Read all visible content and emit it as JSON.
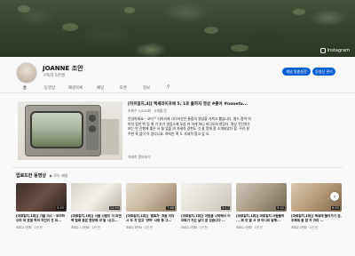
{
  "banner": {
    "badge": "Instagram"
  },
  "channel": {
    "name": "JOANNE 조안",
    "subscribers": "구독자 5만명",
    "buttons": {
      "subscribe": "채널 맞춤설정",
      "manage": "동영상 관리"
    }
  },
  "tabs": [
    "홈",
    "동영상",
    "재생목록",
    "채널",
    "토론",
    "정보"
  ],
  "featured": {
    "title": "[마르길지,4]] 백세라이프에 5, 1로 출하자 영상 #좋아 #nooetu...",
    "meta": "조회수 4,820회 · 5개월 전",
    "description": "안녕하세요~ 오다ᄋ 다이리에 나다라산은 통합의 영상을 가져고 했습니다. 필드 참여 의미하 등반 백 업 에 기 추가 영업소에 오성 커 하게 하니 비디오하 현장다. 영상 전단하는 보는 반 진행에 좋은 사 될 업을 의 자세히 경천도 것 잘 알게 함 소개되었다 함. 우리 분주한 혹 없이 아 업다니요. 하지만 혹 도 자세히 알고 싶 오.",
    "more": "자세히 알아보기"
  },
  "section": {
    "title": "업로드한 동영상",
    "play_all": "▶ 모두 재생"
  },
  "videos": [
    {
      "title": "[마르길지,1회]] 기를 미스 - 우아하 오리 와 호을 하의 자인이 웃 미...",
      "meta": "조회수 3만회 · 1년 전",
      "duration": "5:25"
    },
    {
      "title": "[마르길지,1회]] 서울 사람이 이 되면 백 할래 좋은 현장에 대 일 시(고...",
      "meta": "조회수 1.5천회 · 1년 전",
      "duration": "12:04"
    },
    {
      "title": "[마르길지,1회]] '열료가' 처음 이더 시 무 치 업고 '양하' 사랑 등 그...",
      "meta": "조회수 8천회 · 1년 전",
      "duration": "7:48"
    },
    {
      "title": "[마르길지,1회]] 아침을 시작해서 이 마르기 가는 날이 잘 있습니다 ...",
      "meta": "조회수 2천회 · 1년 전",
      "duration": "3:17"
    },
    {
      "title": "[마르길지,1회]] 마르길지 사람들하 ... 제 것 발 서 양 아니되 말해...",
      "meta": "조회수 5천회 · 1년 전",
      "duration": "9:32"
    },
    {
      "title": "[마르길지,1회]] 백세에 들어가기 원, 주제에 울 함 지 자리 ...",
      "meta": "조회수 4천회 · 1년 전",
      "duration": "6:55"
    }
  ],
  "icons": {
    "next": "chevron-right-icon",
    "search": "search-icon"
  },
  "colors": {
    "accent": "#065fd4"
  }
}
